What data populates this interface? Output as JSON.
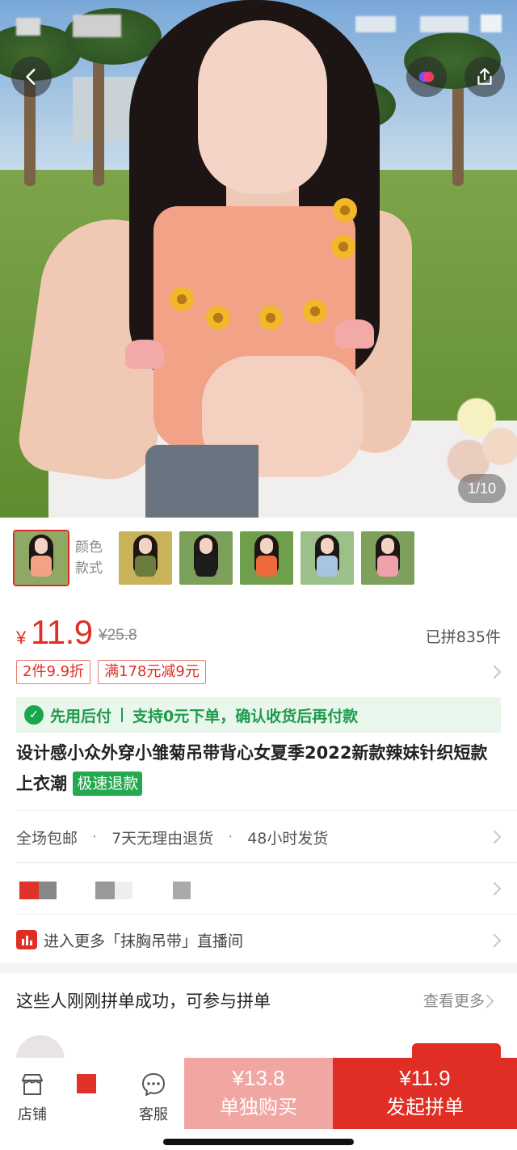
{
  "product_image": {
    "counter": "1/10",
    "back_icon": "back-icon",
    "share_icon": "share-icon",
    "app_icon": "app-circle-icon"
  },
  "variants": {
    "label_line1": "颜色",
    "label_line2": "款式",
    "thumbnails": [
      {
        "bg": "#8fa965",
        "top": "#f2a286"
      },
      {
        "bg": "#c9b35a",
        "top": "#6b7d3a"
      },
      {
        "bg": "#7aa05a",
        "top": "#1d1d1d"
      },
      {
        "bg": "#6f9f4a",
        "top": "#ee6a3c"
      },
      {
        "bg": "#9cc08a",
        "top": "#a7c4e0"
      },
      {
        "bg": "#7ea05c",
        "top": "#f0a0a8"
      }
    ]
  },
  "price": {
    "currency": "¥",
    "current": "11.9",
    "original": "¥25.8",
    "sold": "已拼835件"
  },
  "promo_tags": [
    "2件9.9折",
    "满178元减9元"
  ],
  "pay_later": {
    "badge": "先用后付",
    "text": "支持0元下单，确认收货后再付款"
  },
  "title": {
    "text": "设计感小众外穿小雏菊吊带背心女夏季2022新款辣妹针织短款上衣潮",
    "badge": "极速退款"
  },
  "services": [
    "全场包邮",
    "7天无理由退货",
    "48小时发货"
  ],
  "live": {
    "text": "进入更多「抹胸吊带」直播间"
  },
  "group_buy": {
    "title": "这些人刚刚拼单成功，可参与拼单",
    "more": "查看更多"
  },
  "bottom_bar": {
    "store_label": "店铺",
    "service_label": "客服",
    "solo_price": "¥13.8",
    "solo_label": "单独购买",
    "group_price": "¥11.9",
    "group_label": "发起拼单"
  },
  "colors": {
    "accent": "#e02e24",
    "green": "#1c9b4b",
    "solo_bg": "#f2a6a1"
  }
}
